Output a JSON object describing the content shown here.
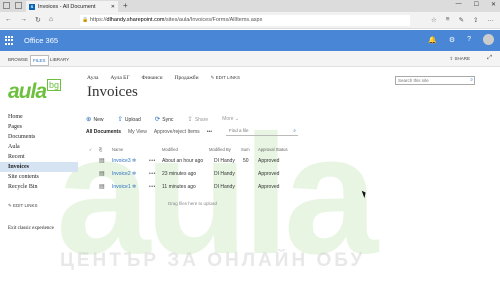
{
  "browser": {
    "tab_title": "Invoices - All Document",
    "tab_favicon": "S",
    "tab_close": "✕",
    "new_tab": "+",
    "win_controls": [
      "—",
      "☐",
      "✕"
    ],
    "url_prefix": "https://",
    "url_domain": "dlhandy.sharepoint.com",
    "url_path": "/sites/aula/Invoices/Forms/AllItems.aspx",
    "nav_icons": [
      "back-icon",
      "forward-icon",
      "refresh-icon",
      "home-icon"
    ],
    "nav_glyphs": [
      "←",
      "→",
      "↻",
      "⌂"
    ],
    "toolbar_glyphs": [
      "☆",
      "≡",
      "✎",
      "⇪",
      "…"
    ]
  },
  "suite": {
    "brand": "Office 365",
    "bar_color": "#4987d6",
    "icons": [
      "bell-icon",
      "gear-icon",
      "help-icon",
      "avatar"
    ],
    "icon_glyphs": [
      "🔔",
      "⚙",
      "?"
    ]
  },
  "ribbon": {
    "tabs": [
      "BROWSE",
      "FILES",
      "LIBRARY"
    ],
    "active_tab": "FILES",
    "share": "SHARE",
    "share_glyph": "⇪",
    "focus_glyph": "⤢"
  },
  "watermark": {
    "logo": "aula",
    "tagline": "ЦЕНТЪР ЗА ОНЛАЙН ОБУ"
  },
  "logo": {
    "text": "aula",
    "suffix": "bg",
    "color": "#6dc03e"
  },
  "leftnav": {
    "items": [
      "Home",
      "Pages",
      "Documents",
      "Aula",
      "Recent",
      "Invoices",
      "Site contents",
      "Recycle Bin"
    ],
    "active": "Invoices",
    "edit_links": "EDIT LINKS",
    "edit_glyph": "✎",
    "exit": "Exit classic experience"
  },
  "topnav": {
    "links": [
      "Аула",
      "Аула БГ",
      "Финанси",
      "Продажби"
    ],
    "edit_links": "EDIT LINKS",
    "edit_glyph": "✎"
  },
  "search": {
    "placeholder": "Search this site",
    "glyph": "⌕"
  },
  "page": {
    "title": "Invoices"
  },
  "commands": [
    {
      "label": "New",
      "icon": "plus-icon",
      "glyph": "⊕",
      "enabled": true
    },
    {
      "label": "Upload",
      "icon": "upload-icon",
      "glyph": "⇧",
      "enabled": true
    },
    {
      "label": "Sync",
      "icon": "sync-icon",
      "glyph": "⟳",
      "enabled": true
    },
    {
      "label": "Share",
      "icon": "share-icon",
      "glyph": "⇪",
      "enabled": false
    },
    {
      "label": "More ⌄",
      "icon": "",
      "glyph": "",
      "enabled": false
    }
  ],
  "views": {
    "items": [
      "All Documents",
      "My View",
      "Approve/reject Items",
      "•••"
    ],
    "current": "All Documents",
    "find_placeholder": "Find a file",
    "find_glyph": "⌕"
  },
  "table": {
    "headers": [
      "✓",
      "⎘",
      "Name",
      "Modified",
      "Modified By",
      "Sum",
      "Approval Status"
    ],
    "rows": [
      {
        "name": "Invoice3 ✲",
        "modified": "About an hour ago",
        "modified_by": "DI Handy",
        "sum": "50",
        "status": "Approved"
      },
      {
        "name": "Invoice2 ✲",
        "modified": "23 minutes ago",
        "modified_by": "DI Handy",
        "sum": "",
        "status": "Approved"
      },
      {
        "name": "Invoice1 ✲",
        "modified": "11 minutes ago",
        "modified_by": "DI Handy",
        "sum": "",
        "status": "Approved"
      }
    ],
    "doc_glyph": "▤",
    "dots": "•••",
    "drop_hint": "Drag files here to upload"
  }
}
